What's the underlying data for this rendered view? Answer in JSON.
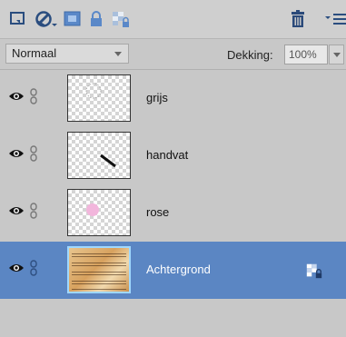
{
  "toolbar": {
    "icons": [
      "new-layer-icon",
      "adjustment-layer-icon",
      "mask-icon",
      "lock-icon",
      "lock-transparent-icon",
      "trash-icon",
      "panel-menu-icon"
    ]
  },
  "blend": {
    "mode": "Normaal"
  },
  "opacity": {
    "label": "Dekking:",
    "value": "100%"
  },
  "layers": [
    {
      "name": "grijs"
    },
    {
      "name": "handvat"
    },
    {
      "name": "rose"
    },
    {
      "name": "Achtergrond",
      "selected": true
    }
  ],
  "colors": {
    "selected_row": "#5b86c3",
    "panel": "#c8c8c8",
    "accent_trash": "#2b4a7a"
  }
}
